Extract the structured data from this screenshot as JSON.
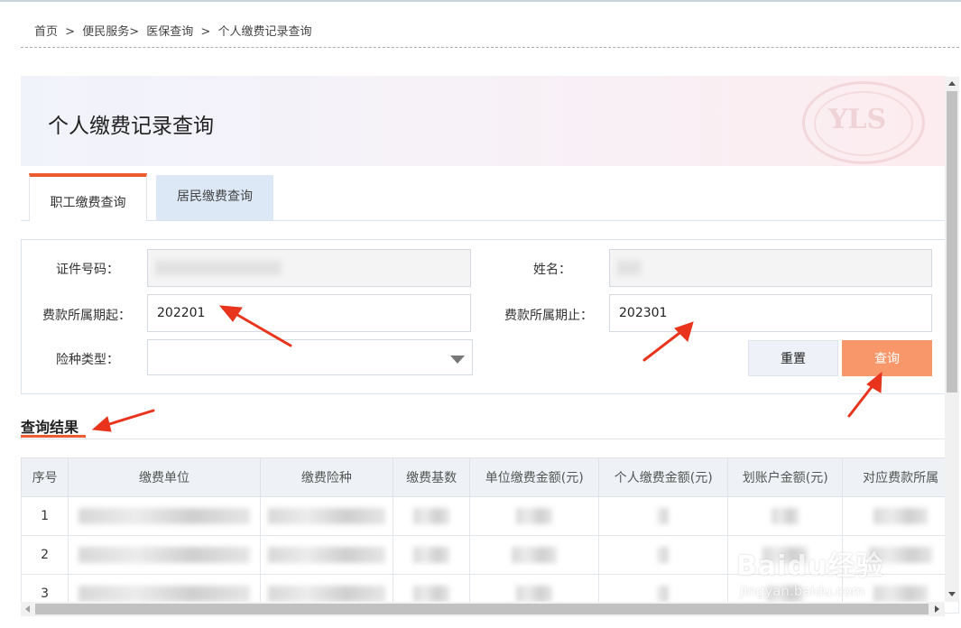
{
  "breadcrumb": {
    "home": "首页",
    "sep1": ">",
    "service": "便民服务>",
    "medical": "医保查询",
    "sep2": ">",
    "current": "个人缴费记录查询"
  },
  "banner": {
    "title": "个人缴费记录查询"
  },
  "tabs": [
    {
      "label": "职工缴费查询",
      "active": true
    },
    {
      "label": "居民缴费查询",
      "active": false
    }
  ],
  "form": {
    "id_label": "证件号码：",
    "id_value": "",
    "name_label": "姓名：",
    "name_value": "",
    "start_label": "费款所属期起：",
    "start_value": "202201",
    "end_label": "费款所属期止：",
    "end_value": "202301",
    "type_label": "险种类型：",
    "type_value": "",
    "reset_label": "重置",
    "query_label": "查询"
  },
  "result": {
    "title": "查询结果",
    "columns": [
      "序号",
      "缴费单位",
      "缴费险种",
      "缴费基数",
      "单位缴费金额(元)",
      "个人缴费金额(元)",
      "划账户金额(元)",
      "对应费款所属"
    ],
    "rows": [
      {
        "no": "1"
      },
      {
        "no": "2"
      },
      {
        "no": "3"
      }
    ]
  },
  "watermark": {
    "brand": "Baidu经验",
    "url": "jingyan.baidu.com"
  },
  "colors": {
    "accent": "#ec5c31",
    "query_button": "#f7976a",
    "tab_idle": "#dde8f7",
    "arrow": "#e8341c"
  }
}
